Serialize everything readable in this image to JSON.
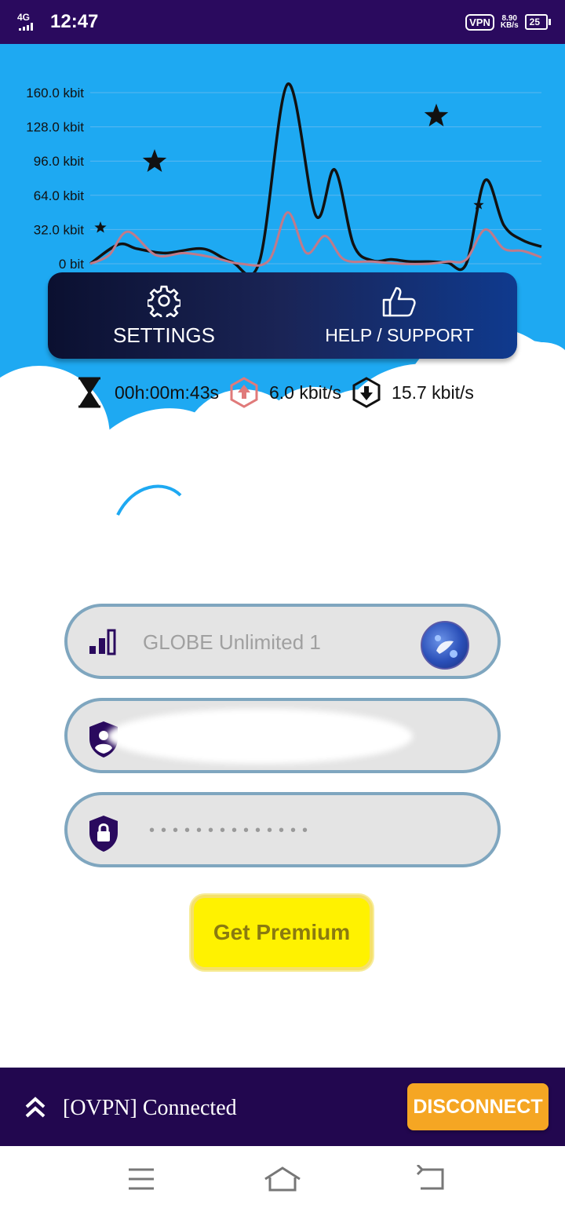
{
  "status_bar": {
    "network": "4G",
    "time": "12:47",
    "vpn_badge": "VPN",
    "net_speed_value": "8.90",
    "net_speed_unit": "KB/s",
    "battery": "25"
  },
  "chart_data": {
    "type": "line",
    "yticks": [
      "160.0 kbit",
      "128.0 kbit",
      "96.0 kbit",
      "64.0 kbit",
      "32.0 kbit",
      "0 bit"
    ],
    "ylim": [
      0,
      170
    ],
    "xlim": [
      0,
      48
    ],
    "grid": true,
    "series": [
      {
        "color": "#111111",
        "x": [
          0,
          3,
          5,
          8,
          12,
          15,
          18,
          21,
          24,
          26,
          28,
          30,
          32,
          34,
          36,
          38,
          40,
          42,
          44,
          46,
          48
        ],
        "values": [
          0,
          18,
          14,
          10,
          14,
          2,
          2,
          168,
          45,
          88,
          18,
          3,
          4,
          2,
          2,
          1,
          0,
          78,
          36,
          22,
          16
        ]
      },
      {
        "color": "#c07a8a",
        "x": [
          0,
          2,
          4,
          7,
          10,
          13,
          16,
          19,
          21,
          23,
          25,
          27,
          30,
          33,
          36,
          38,
          40,
          42,
          44,
          46,
          48
        ],
        "values": [
          0,
          8,
          30,
          8,
          10,
          6,
          0,
          3,
          48,
          10,
          26,
          4,
          2,
          0,
          0,
          2,
          4,
          32,
          14,
          12,
          6
        ]
      }
    ]
  },
  "actions": {
    "settings_label": "SETTINGS",
    "help_label": "HELP / SUPPORT"
  },
  "stats": {
    "elapsed": "00h:00m:43s",
    "upload": "6.0 kbit/s",
    "download": "15.7 kbit/s"
  },
  "form": {
    "network_option": "GLOBE Unlimited 1",
    "password_mask": "••••••••••••••"
  },
  "premium_label": "Get Premium",
  "connection": {
    "status": "[OVPN] Connected",
    "disconnect_label": "DISCONNECT"
  },
  "colors": {
    "status_bar": "#2a0a5e",
    "sky": "#1ea9f2",
    "bottom_bar": "#22074f",
    "premium": "#fff200",
    "disconnect": "#f5a623"
  }
}
